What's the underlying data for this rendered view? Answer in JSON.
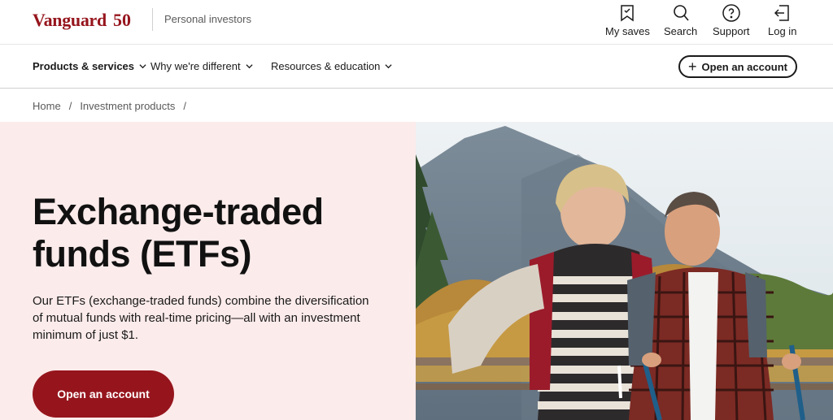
{
  "header": {
    "brand": "Vanguard",
    "anniversary": "50",
    "tagline": "Personal investors",
    "utility": [
      {
        "label": "My saves",
        "icon": "bookmark-icon"
      },
      {
        "label": "Search",
        "icon": "search-icon"
      },
      {
        "label": "Support",
        "icon": "help-icon"
      },
      {
        "label": "Log in",
        "icon": "login-icon"
      }
    ]
  },
  "nav": {
    "items": [
      {
        "label": "Products & services"
      },
      {
        "label": "Why we're different"
      },
      {
        "label": "Resources & education"
      }
    ],
    "open_account": "Open an account"
  },
  "breadcrumb": {
    "items": [
      "Home",
      "Investment products"
    ],
    "separator": "/"
  },
  "hero": {
    "title": "Exchange-traded funds (ETFs)",
    "description": "Our ETFs (exchange-traded funds) combine the diversification of mutual funds with real-time pricing—all with an investment minimum of just $1.",
    "cta": "Open an account",
    "image_alt": "hikers-photo"
  },
  "colors": {
    "brand": "#96151d",
    "hero_bg": "#fcebeb"
  }
}
